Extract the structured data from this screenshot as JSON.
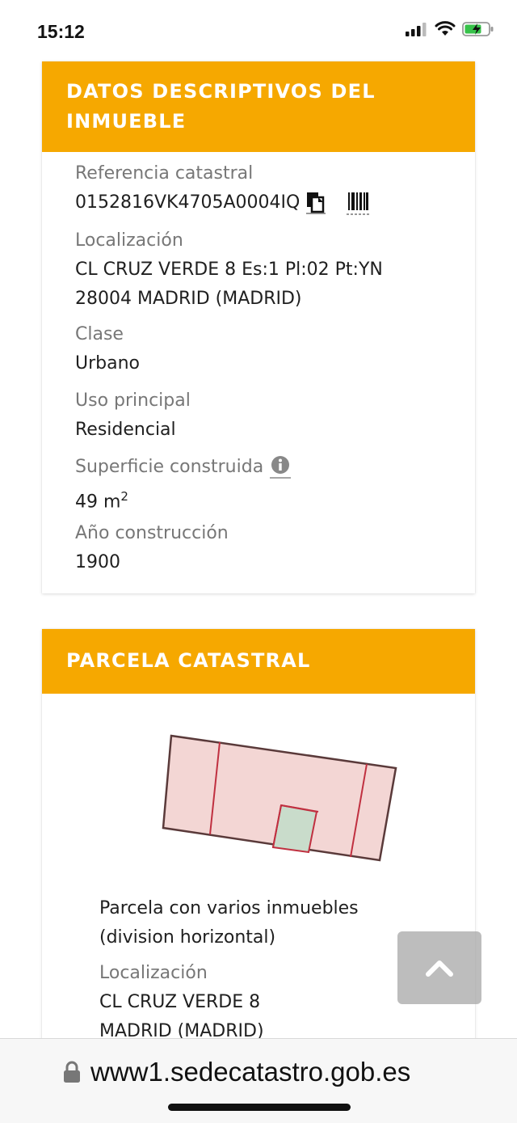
{
  "status_bar": {
    "time": "15:12"
  },
  "section_inmueble": {
    "title_line1": "DATOS DESCRIPTIVOS DEL",
    "title_line2": "INMUEBLE",
    "referencia": {
      "label": "Referencia catastral",
      "value": "0152816VK4705A0004IQ"
    },
    "localizacion": {
      "label": "Localización",
      "line1": "CL CRUZ VERDE 8 Es:1 Pl:02 Pt:YN",
      "line2": "28004 MADRID (MADRID)"
    },
    "clase": {
      "label": "Clase",
      "value": "Urbano"
    },
    "uso": {
      "label": "Uso principal",
      "value": "Residencial"
    },
    "superficie": {
      "label": "Superficie construida",
      "value": "49 m",
      "unit_sup": "2"
    },
    "anio": {
      "label": "Año construcción",
      "value": "1900"
    }
  },
  "section_parcela": {
    "title": "PARCELA CATASTRAL",
    "description_line1": "Parcela con varios inmuebles",
    "description_line2": "(division horizontal)",
    "localizacion": {
      "label": "Localización",
      "line1": "CL CRUZ VERDE 8",
      "line2": "MADRID (MADRID)"
    }
  },
  "browser": {
    "url": "www1.sedecatastro.gob.es"
  },
  "colors": {
    "accent": "#f6a800",
    "parcel_fill": "#f3d6d4",
    "parcel_highlight": "#c9dccb",
    "parcel_line": "#c03040"
  }
}
